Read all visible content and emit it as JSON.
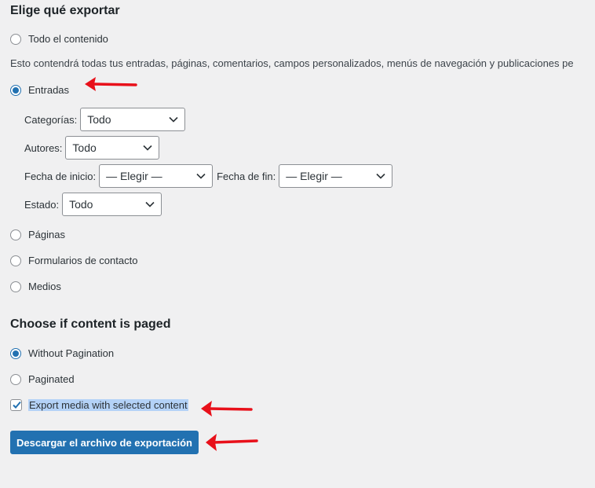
{
  "export_section": {
    "title": "Elige qué exportar",
    "all_content_label": "Todo el contenido",
    "all_content_description": "Esto contendrá todas tus entradas, páginas, comentarios, campos personalizados, menús de navegación y publicaciones pe",
    "posts_label": "Entradas",
    "filters": {
      "categories_label": "Categorías:",
      "categories_value": "Todo",
      "authors_label": "Autores:",
      "authors_value": "Todo",
      "start_date_label": "Fecha de inicio:",
      "start_date_value": "— Elegir —",
      "end_date_label": "Fecha de fin:",
      "end_date_value": "— Elegir —",
      "status_label": "Estado:",
      "status_value": "Todo"
    },
    "pages_label": "Páginas",
    "contact_forms_label": "Formularios de contacto",
    "media_label": "Medios",
    "selected": "Entradas"
  },
  "paging_section": {
    "title": "Choose if content is paged",
    "without_pagination_label": "Without Pagination",
    "paginated_label": "Paginated",
    "selected": "Without Pagination"
  },
  "export_media_label": "Export media with selected content",
  "export_media_checked": true,
  "download_button_label": "Descargar el archivo de exportación",
  "colors": {
    "accent": "#2271b1",
    "annotation_arrow": "#e8101a",
    "text_highlight": "#b4d2f7",
    "background": "#f0f0f1"
  }
}
